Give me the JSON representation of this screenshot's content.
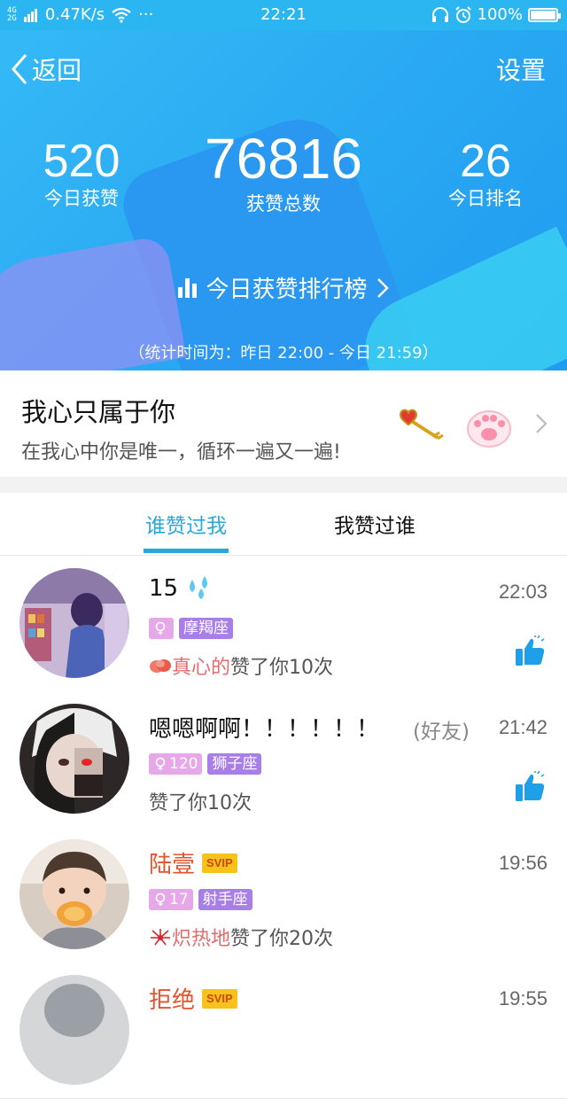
{
  "status_bar": {
    "net_top": "4G",
    "net_bottom": "2G",
    "speed": "0.47K/s",
    "dots": "···",
    "time": "22:21",
    "battery_text": "100%",
    "battery_level": 1.0
  },
  "header": {
    "back_label": "返回",
    "settings_label": "设置",
    "today_likes": "520",
    "today_likes_label": "今日获赞",
    "total_likes": "76816",
    "total_likes_label": "获赞总数",
    "today_rank": "26",
    "today_rank_label": "今日排名",
    "rank_link_label": "今日获赞排行榜",
    "stat_time": "（统计时间为：昨日 22:00 - 今日 21:59）"
  },
  "banner": {
    "title": "我心只属于你",
    "subtitle": "在我心中你是唯一，循环一遍又一遍!"
  },
  "tabs": [
    {
      "label": "谁赞过我",
      "active": true
    },
    {
      "label": "我赞过谁",
      "active": false
    }
  ],
  "list": [
    {
      "name": "15",
      "time": "22:03",
      "tags": [
        {
          "text": "",
          "kind": "female"
        },
        {
          "text": "摩羯座",
          "kind": "zodiac"
        }
      ],
      "liked_prefix": "真心的",
      "liked_text": "赞了你10次"
    },
    {
      "name": "嗯嗯啊啊！！！！！！",
      "friend": "(好友)",
      "time": "21:42",
      "tags": [
        {
          "text": "120",
          "kind": "female"
        },
        {
          "text": "狮子座",
          "kind": "zodiac"
        }
      ],
      "liked_prefix": "",
      "liked_text": "赞了你10次"
    },
    {
      "name": "陆壹",
      "svip": "SVIP",
      "time": "19:56",
      "tags": [
        {
          "text": "17",
          "kind": "female"
        },
        {
          "text": "射手座",
          "kind": "zodiac"
        }
      ],
      "liked_prefix": "炽热地",
      "liked_text": "赞了你20次"
    },
    {
      "name": "拒绝",
      "svip": "SVIP",
      "time": "19:55"
    }
  ],
  "colors": {
    "header_blue": "#2aa9f2",
    "accent": "#2aa8dc",
    "tag_pink": "#e6a8e8",
    "tag_purple": "#a87ee9",
    "name_red": "#e5532d"
  }
}
